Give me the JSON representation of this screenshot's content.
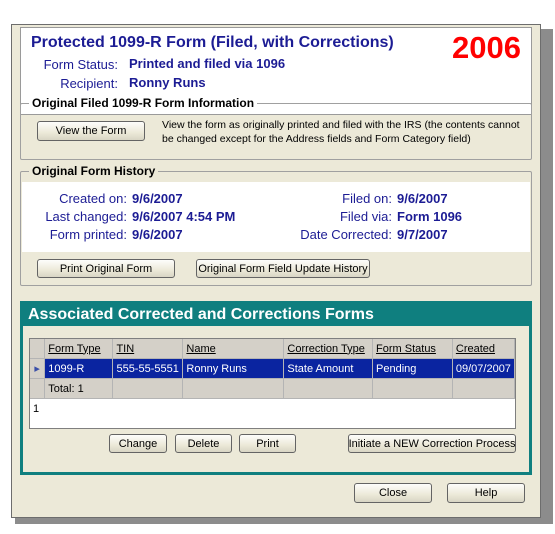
{
  "header": {
    "title": "Protected 1099-R Form (Filed, with Corrections)",
    "year": "2006",
    "form_status_label": "Form Status:",
    "form_status_value": "Printed and filed via 1096",
    "recipient_label": "Recipient:",
    "recipient_value": "Ronny Runs"
  },
  "original_info": {
    "legend": "Original Filed 1099-R Form Information",
    "view_button": "View the Form",
    "description": "View the form as originally printed and filed with the IRS (the contents cannot be changed except for the Address fields and Form Category field)"
  },
  "history": {
    "legend": "Original Form History",
    "created_label": "Created on:",
    "created_value": "9/6/2007",
    "changed_label": "Last changed:",
    "changed_value": "9/6/2007 4:54 PM",
    "printed_label": "Form printed:",
    "printed_value": "9/6/2007",
    "filed_on_label": "Filed on:",
    "filed_on_value": "9/6/2007",
    "filed_via_label": "Filed via:",
    "filed_via_value": "Form 1096",
    "corrected_label": "Date Corrected:",
    "corrected_value": "9/7/2007",
    "print_button": "Print Original Form",
    "update_history_button": "Original Form Field Update History"
  },
  "associated": {
    "title": "Associated Corrected and Corrections Forms",
    "columns": [
      "Form Type",
      "TIN",
      "Name",
      "Correction Type",
      "Form Status",
      "Created"
    ],
    "row": {
      "indicator": "▸",
      "form_type": "1099-R",
      "tin": "555-55-5551",
      "name": "Ronny Runs",
      "correction_type": "State Amount",
      "form_status": "Pending",
      "created": "09/07/2007"
    },
    "total": "Total: 1",
    "page_number": "1",
    "change_button": "Change",
    "delete_button": "Delete",
    "print_button": "Print",
    "initiate_button": "Initiate a NEW Correction Process"
  },
  "footer": {
    "close_button": "Close",
    "help_button": "Help"
  },
  "colors": {
    "title": "#1c1c94",
    "year": "#ff0000",
    "teal": "#0f7f7f",
    "selection": "#0a24a0",
    "window_bg": "#ece9d8"
  }
}
